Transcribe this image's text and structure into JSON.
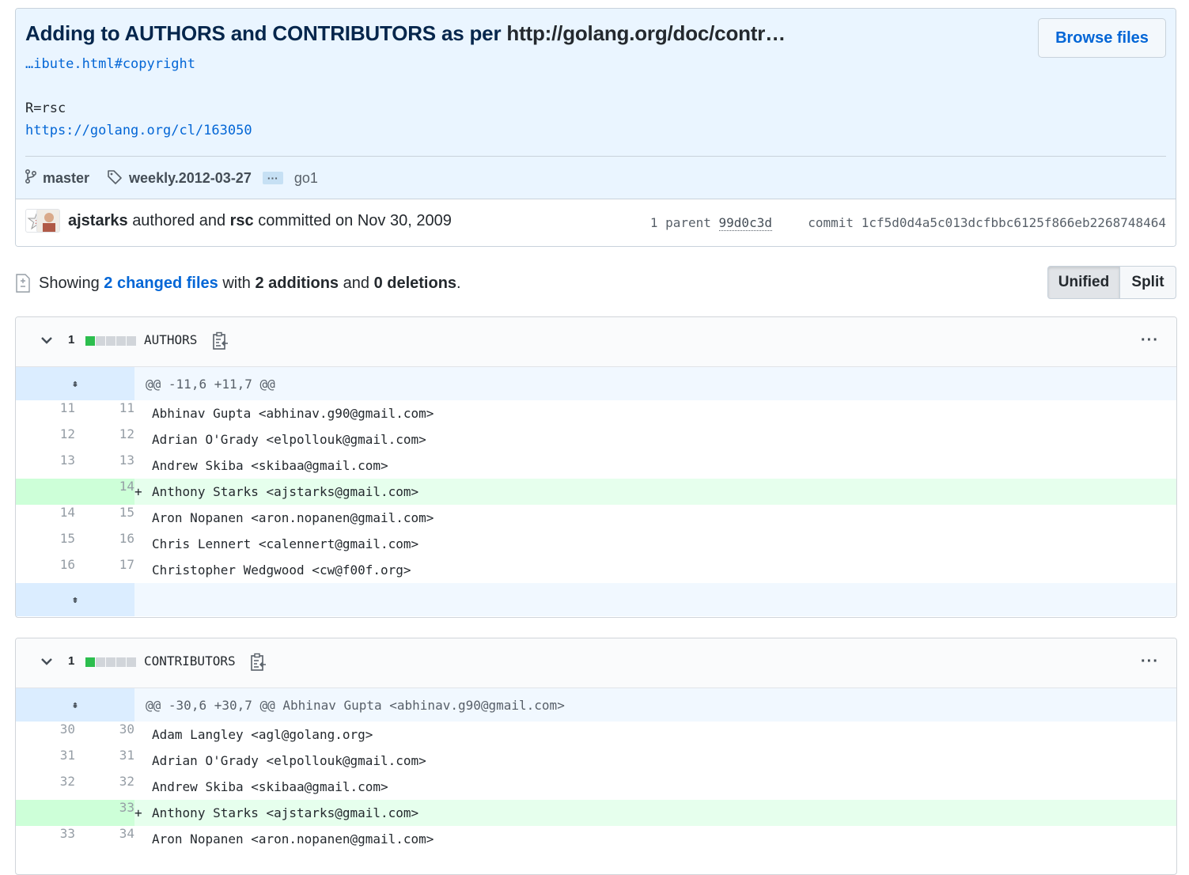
{
  "commit": {
    "title": "Adding to AUTHORS and CONTRIBUTORS as per",
    "title_link": "http://golang.org/doc/contr…",
    "message_lines": [
      "…ibute.html#copyright",
      "R=rsc",
      "https://golang.org/cl/163050"
    ],
    "browse_files_label": "Browse files",
    "branch": "master",
    "tag": "weekly.2012-03-27",
    "tag_more": "···",
    "tag_last": "go1",
    "author": "ajstarks",
    "authored_text": "authored and",
    "committer": "rsc",
    "committed_text": "committed on Nov 30, 2009",
    "parent_label": "1 parent",
    "parent_sha": "99d0c3d",
    "commit_label": "commit",
    "commit_sha": "1cf5d0d4a5c013dcfbbc6125f866eb2268748464"
  },
  "summary": {
    "showing": "Showing",
    "changed_files": "2 changed files",
    "with": "with",
    "additions": "2 additions",
    "and": "and",
    "deletions": "0 deletions",
    "period": "."
  },
  "view_toggle": {
    "unified": "Unified",
    "split": "Split"
  },
  "files": [
    {
      "changes": "1",
      "name": "AUTHORS",
      "more": "···",
      "hunk": "@@ -11,6 +11,7 @@",
      "lines": [
        {
          "old": "11",
          "new": "11",
          "type": "ctx",
          "text": "Abhinav Gupta <abhinav.g90@gmail.com>"
        },
        {
          "old": "12",
          "new": "12",
          "type": "ctx",
          "text": "Adrian O'Grady <elpollouk@gmail.com>"
        },
        {
          "old": "13",
          "new": "13",
          "type": "ctx",
          "text": "Andrew Skiba <skibaa@gmail.com>"
        },
        {
          "old": "",
          "new": "14",
          "type": "add",
          "marker": "+",
          "text": "Anthony Starks <ajstarks@gmail.com>"
        },
        {
          "old": "14",
          "new": "15",
          "type": "ctx",
          "text": "Aron Nopanen <aron.nopanen@gmail.com>"
        },
        {
          "old": "15",
          "new": "16",
          "type": "ctx",
          "text": "Chris Lennert <calennert@gmail.com>"
        },
        {
          "old": "16",
          "new": "17",
          "type": "ctx",
          "text": "Christopher Wedgwood <cw@f00f.org>"
        }
      ]
    },
    {
      "changes": "1",
      "name": "CONTRIBUTORS",
      "more": "···",
      "hunk": "@@ -30,6 +30,7 @@ Abhinav Gupta <abhinav.g90@gmail.com>",
      "lines": [
        {
          "old": "30",
          "new": "30",
          "type": "ctx",
          "text": "Adam Langley <agl@golang.org>"
        },
        {
          "old": "31",
          "new": "31",
          "type": "ctx",
          "text": "Adrian O'Grady <elpollouk@gmail.com>"
        },
        {
          "old": "32",
          "new": "32",
          "type": "ctx",
          "text": "Andrew Skiba <skibaa@gmail.com>"
        },
        {
          "old": "",
          "new": "33",
          "type": "add",
          "marker": "+",
          "text": "Anthony Starks <ajstarks@gmail.com>"
        },
        {
          "old": "33",
          "new": "34",
          "type": "ctx",
          "text": "Aron Nopanen <aron.nopanen@gmail.com>"
        }
      ]
    }
  ],
  "colors": {
    "link": "#0366d6",
    "addition_bg": "#e6ffed",
    "addition_num_bg": "#cdffd8",
    "hunk_bg": "#f1f8ff",
    "diffstat_add": "#2cbe4e"
  },
  "icons": [
    "git-branch-icon",
    "tag-icon",
    "diff-icon",
    "chevron-down-icon",
    "clipboard-icon",
    "expand-icon"
  ]
}
